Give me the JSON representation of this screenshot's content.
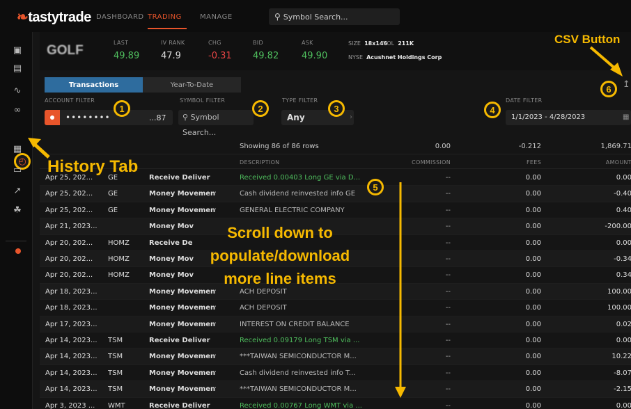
{
  "app": {
    "name": "tastytrade",
    "brand_color": "#e8552b",
    "annotation_color": "#f6b900"
  },
  "nav": {
    "tabs": [
      {
        "label": "DASHBOARD"
      },
      {
        "label": "TRADING"
      },
      {
        "label": "MANAGE"
      }
    ],
    "active_tab": "TRADING",
    "search_placeholder": "Symbol Search..."
  },
  "sidebar": {
    "icons": [
      "briefcase-icon",
      "clipboard-icon",
      "activity-icon",
      "binoculars-icon",
      "history-icon",
      "calculator-icon",
      "tv-icon",
      "chart-icon",
      "community-icon"
    ],
    "active": "history-icon"
  },
  "quote": {
    "symbol": "GOLF",
    "last_label": "LAST",
    "last": "49.89",
    "ivrank_label": "IV RANK",
    "ivrank": "47.9",
    "chg_label": "CHG",
    "chg": "-0.31",
    "bid_label": "BID",
    "bid": "49.82",
    "ask_label": "ASK",
    "ask": "49.90",
    "size_label": "SIZE",
    "size": "18x146",
    "vol_label": "VOL",
    "vol": "211K",
    "exchange": "NYSE",
    "company": "Acushnet Holdings Corp"
  },
  "tabs": {
    "transactions": "Transactions",
    "ytd": "Year-To-Date"
  },
  "filters": {
    "account_label": "ACCOUNT FILTER",
    "account_mask": "••••••••",
    "account_suffix": "...87",
    "symbol_label": "SYMBOL FILTER",
    "symbol_placeholder": "Symbol Search...",
    "type_label": "TYPE FILTER",
    "type_value": "Any",
    "date_label": "DATE FILTER",
    "date_value": "1/1/2023 - 4/28/2023"
  },
  "summary": {
    "showing": "Showing 86 of 86 rows",
    "commission": "0.00",
    "fees": "-0.212",
    "amount": "1,869.71"
  },
  "headers": {
    "description": "DESCRIPTION",
    "commission": "COMMISSION",
    "fees": "FEES",
    "amount": "AMOUNT"
  },
  "rows": [
    {
      "date": "Apr 25, 202...",
      "symbol": "GE",
      "type": "Receive Deliver",
      "description": "Received 0.00403 Long GE via D...",
      "commission": "--",
      "fees": "0.00",
      "amount": "0.00",
      "green": true
    },
    {
      "date": "Apr 25, 202...",
      "symbol": "GE",
      "type": "Money Movement",
      "description": "Cash dividend reinvested info GE",
      "commission": "--",
      "fees": "0.00",
      "amount": "-0.40",
      "green": false
    },
    {
      "date": "Apr 25, 202...",
      "symbol": "GE",
      "type": "Money Movement",
      "description": "GENERAL ELECTRIC COMPANY",
      "commission": "--",
      "fees": "0.00",
      "amount": "0.40",
      "green": false
    },
    {
      "date": "Apr 21, 2023...",
      "symbol": "",
      "type": "Money Mov",
      "description": "",
      "commission": "--",
      "fees": "0.00",
      "amount": "-200.00",
      "green": false
    },
    {
      "date": "Apr 20, 202...",
      "symbol": "HOMZ",
      "type": "Receive De",
      "description": "",
      "commission": "--",
      "fees": "0.00",
      "amount": "0.00",
      "green": false
    },
    {
      "date": "Apr 20, 202...",
      "symbol": "HOMZ",
      "type": "Money Mov",
      "description": "",
      "commission": "--",
      "fees": "0.00",
      "amount": "-0.34",
      "green": false
    },
    {
      "date": "Apr 20, 202...",
      "symbol": "HOMZ",
      "type": "Money Mov",
      "description": "",
      "commission": "--",
      "fees": "0.00",
      "amount": "0.34",
      "green": false
    },
    {
      "date": "Apr 18, 2023...",
      "symbol": "",
      "type": "Money Movement",
      "description": "ACH DEPOSIT",
      "commission": "--",
      "fees": "0.00",
      "amount": "100.00",
      "green": false
    },
    {
      "date": "Apr 18, 2023...",
      "symbol": "",
      "type": "Money Movement",
      "description": "ACH DEPOSIT",
      "commission": "--",
      "fees": "0.00",
      "amount": "100.00",
      "green": false
    },
    {
      "date": "Apr 17, 2023...",
      "symbol": "",
      "type": "Money Movement",
      "description": "INTEREST ON CREDIT BALANCE",
      "commission": "--",
      "fees": "0.00",
      "amount": "0.02",
      "green": false
    },
    {
      "date": "Apr 14, 2023...",
      "symbol": "TSM",
      "type": "Receive Deliver",
      "description": "Received 0.09179 Long TSM via ...",
      "commission": "--",
      "fees": "0.00",
      "amount": "0.00",
      "green": true
    },
    {
      "date": "Apr 14, 2023...",
      "symbol": "TSM",
      "type": "Money Movement",
      "description": "***TAIWAN SEMICONDUCTOR M...",
      "commission": "--",
      "fees": "0.00",
      "amount": "10.22",
      "green": false
    },
    {
      "date": "Apr 14, 2023...",
      "symbol": "TSM",
      "type": "Money Movement",
      "description": "Cash dividend reinvested info T...",
      "commission": "--",
      "fees": "0.00",
      "amount": "-8.07",
      "green": false
    },
    {
      "date": "Apr 14, 2023...",
      "symbol": "TSM",
      "type": "Money Movement",
      "description": "***TAIWAN SEMICONDUCTOR M...",
      "commission": "--",
      "fees": "0.00",
      "amount": "-2.15",
      "green": false
    },
    {
      "date": "Apr 3, 2023 ...",
      "symbol": "WMT",
      "type": "Receive Deliver",
      "description": "Received 0.00767 Long WMT via ...",
      "commission": "--",
      "fees": "0.00",
      "amount": "0.00",
      "green": true
    }
  ],
  "annotations": {
    "csv_button": "CSV Button",
    "history_tab": "History Tab",
    "scroll_note_lines": [
      "Scroll down to",
      "populate/download",
      "more line items"
    ],
    "badges": [
      "1",
      "2",
      "3",
      "4",
      "5",
      "6"
    ]
  }
}
